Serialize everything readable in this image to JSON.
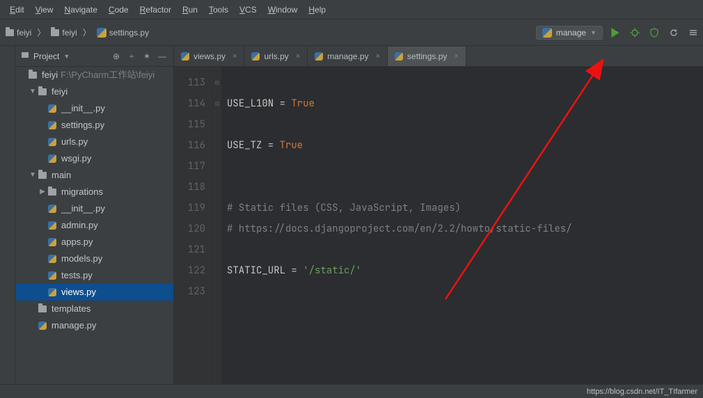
{
  "menu": [
    "Edit",
    "View",
    "Navigate",
    "Code",
    "Refactor",
    "Run",
    "Tools",
    "VCS",
    "Window",
    "Help"
  ],
  "breadcrumbs": [
    {
      "label": "feiyi",
      "icon": "folder"
    },
    {
      "label": "feiyi",
      "icon": "folder"
    },
    {
      "label": "settings.py",
      "icon": "python"
    }
  ],
  "run_config": {
    "name": "manage"
  },
  "toolbar_icons": [
    "play",
    "debug",
    "coverage",
    "stop",
    "more"
  ],
  "project_panel": {
    "title": "Project"
  },
  "tree": {
    "root": {
      "name": "feiyi",
      "path": "F:\\PyCharm工作站\\feiyi"
    },
    "items": [
      {
        "level": 1,
        "arrow": "",
        "icon": "folder",
        "label": "feiyi",
        "extra": "F:\\PyCharm工作站\\feiyi"
      },
      {
        "level": 2,
        "arrow": "▼",
        "icon": "folder",
        "label": "feiyi"
      },
      {
        "level": 3,
        "arrow": "",
        "icon": "python",
        "label": "__init__.py"
      },
      {
        "level": 3,
        "arrow": "",
        "icon": "python",
        "label": "settings.py"
      },
      {
        "level": 3,
        "arrow": "",
        "icon": "python",
        "label": "urls.py"
      },
      {
        "level": 3,
        "arrow": "",
        "icon": "python",
        "label": "wsgi.py"
      },
      {
        "level": 2,
        "arrow": "▼",
        "icon": "folder",
        "label": "main"
      },
      {
        "level": 3,
        "arrow": "▶",
        "icon": "folder",
        "label": "migrations"
      },
      {
        "level": 3,
        "arrow": "",
        "icon": "python",
        "label": "__init__.py"
      },
      {
        "level": 3,
        "arrow": "",
        "icon": "python",
        "label": "admin.py"
      },
      {
        "level": 3,
        "arrow": "",
        "icon": "python",
        "label": "apps.py"
      },
      {
        "level": 3,
        "arrow": "",
        "icon": "python",
        "label": "models.py"
      },
      {
        "level": 3,
        "arrow": "",
        "icon": "python",
        "label": "tests.py"
      },
      {
        "level": 3,
        "arrow": "",
        "icon": "python",
        "label": "views.py",
        "selected": true
      },
      {
        "level": 2,
        "arrow": "",
        "icon": "folder",
        "label": "templates"
      },
      {
        "level": 2,
        "arrow": "",
        "icon": "python",
        "label": "manage.py"
      }
    ]
  },
  "tabs": [
    {
      "label": "views.py",
      "active": false
    },
    {
      "label": "urls.py",
      "active": false
    },
    {
      "label": "manage.py",
      "active": false
    },
    {
      "label": "settings.py",
      "active": true
    }
  ],
  "editor": {
    "lines": [
      {
        "n": 113,
        "segments": []
      },
      {
        "n": 114,
        "segments": [
          {
            "t": "USE_L10N",
            "c": "ident"
          },
          {
            "t": " = ",
            "c": "op"
          },
          {
            "t": "True",
            "c": "kw"
          }
        ]
      },
      {
        "n": 115,
        "segments": []
      },
      {
        "n": 116,
        "segments": [
          {
            "t": "USE_TZ",
            "c": "ident"
          },
          {
            "t": " = ",
            "c": "op"
          },
          {
            "t": "True",
            "c": "kw"
          }
        ]
      },
      {
        "n": 117,
        "segments": []
      },
      {
        "n": 118,
        "segments": []
      },
      {
        "n": 119,
        "segments": [
          {
            "t": "# Static files (CSS, JavaScript, Images)",
            "c": "comment"
          }
        ],
        "fold": "⊟"
      },
      {
        "n": 120,
        "segments": [
          {
            "t": "# https://docs.djangoproject.com/en/2.2/howto/static-files/",
            "c": "comment"
          }
        ],
        "fold": "⊡"
      },
      {
        "n": 121,
        "segments": []
      },
      {
        "n": 122,
        "segments": [
          {
            "t": "STATIC_URL",
            "c": "ident"
          },
          {
            "t": " = ",
            "c": "op"
          },
          {
            "t": "'/static/'",
            "c": "str"
          }
        ]
      },
      {
        "n": 123,
        "segments": []
      }
    ]
  },
  "watermark": "https://blog.csdn.net/IT_TIfarmer"
}
